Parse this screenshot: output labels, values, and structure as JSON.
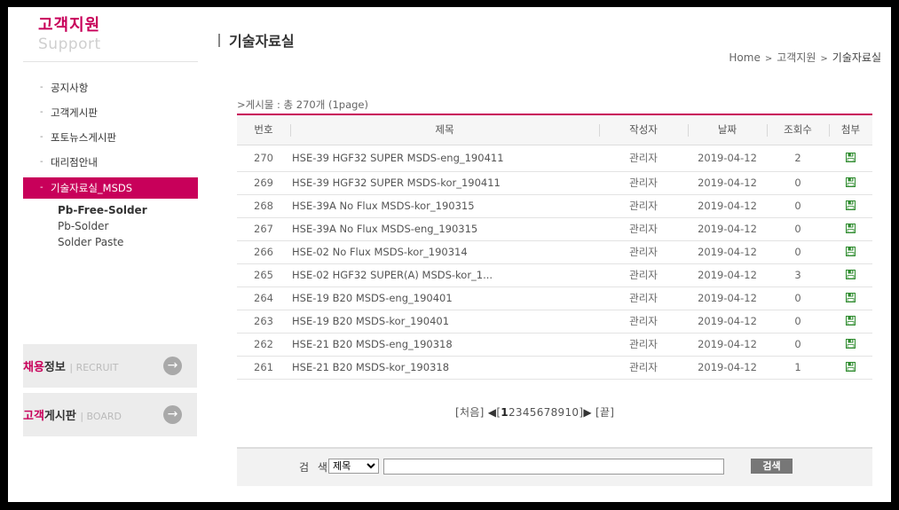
{
  "brand": {
    "ko": "고객지원",
    "en": "Support"
  },
  "sidebar": {
    "items": [
      {
        "label": "공지사항"
      },
      {
        "label": "고객게시판"
      },
      {
        "label": "포토뉴스게시판"
      },
      {
        "label": "대리점안내"
      },
      {
        "label": "기술자료실_MSDS"
      }
    ],
    "active_index": 4,
    "sub_items": [
      {
        "label": "Pb-Free-Solder"
      },
      {
        "label": "Pb-Solder"
      },
      {
        "label": "Solder Paste"
      }
    ],
    "banners": [
      {
        "title_accent": "채용",
        "title_rest": "정보",
        "sub": "| RECRUIT"
      },
      {
        "title_accent": "고객",
        "title_rest": "게시판",
        "sub": "| BOARD"
      }
    ]
  },
  "header": {
    "title": "기술자료실",
    "breadcrumb": [
      "Home",
      "고객지원",
      "기술자료실"
    ],
    "breadcrumb_sep": ">"
  },
  "board": {
    "count_text": ">게시물 : 총 270개 (1page)",
    "columns": [
      "번호",
      "제목",
      "작성자",
      "날짜",
      "조회수",
      "첨부"
    ],
    "rows": [
      {
        "no": "270",
        "title": "HSE-39 HGF32 SUPER MSDS-eng_190411",
        "author": "관리자",
        "date": "2019-04-12",
        "views": "2"
      },
      {
        "no": "269",
        "title": "HSE-39 HGF32 SUPER MSDS-kor_190411",
        "author": "관리자",
        "date": "2019-04-12",
        "views": "0"
      },
      {
        "no": "268",
        "title": "HSE-39A No Flux MSDS-kor_190315",
        "author": "관리자",
        "date": "2019-04-12",
        "views": "0"
      },
      {
        "no": "267",
        "title": "HSE-39A No Flux MSDS-eng_190315",
        "author": "관리자",
        "date": "2019-04-12",
        "views": "0"
      },
      {
        "no": "266",
        "title": "HSE-02 No Flux MSDS-kor_190314",
        "author": "관리자",
        "date": "2019-04-12",
        "views": "0"
      },
      {
        "no": "265",
        "title": "HSE-02 HGF32 SUPER(A) MSDS-kor_1...",
        "author": "관리자",
        "date": "2019-04-12",
        "views": "3"
      },
      {
        "no": "264",
        "title": "HSE-19 B20 MSDS-eng_190401",
        "author": "관리자",
        "date": "2019-04-12",
        "views": "0"
      },
      {
        "no": "263",
        "title": "HSE-19 B20 MSDS-kor_190401",
        "author": "관리자",
        "date": "2019-04-12",
        "views": "0"
      },
      {
        "no": "262",
        "title": "HSE-21 B20 MSDS-eng_190318",
        "author": "관리자",
        "date": "2019-04-12",
        "views": "0"
      },
      {
        "no": "261",
        "title": "HSE-21 B20 MSDS-kor_190318",
        "author": "관리자",
        "date": "2019-04-12",
        "views": "1"
      }
    ],
    "attachment_icon": "floppy-disk-icon"
  },
  "pager": {
    "first": "[처음]",
    "last": "[끝]",
    "open_bracket": "[",
    "close_bracket": "]",
    "pages": [
      "1",
      "2",
      "3",
      "4",
      "5",
      "6",
      "7",
      "8",
      "9",
      "10"
    ],
    "current": "1"
  },
  "search": {
    "label": "검 색",
    "select_value": "제목",
    "input_value": "",
    "button": "검색"
  },
  "colors": {
    "accent": "#c8005a",
    "attachment": "#2e8b2e"
  }
}
